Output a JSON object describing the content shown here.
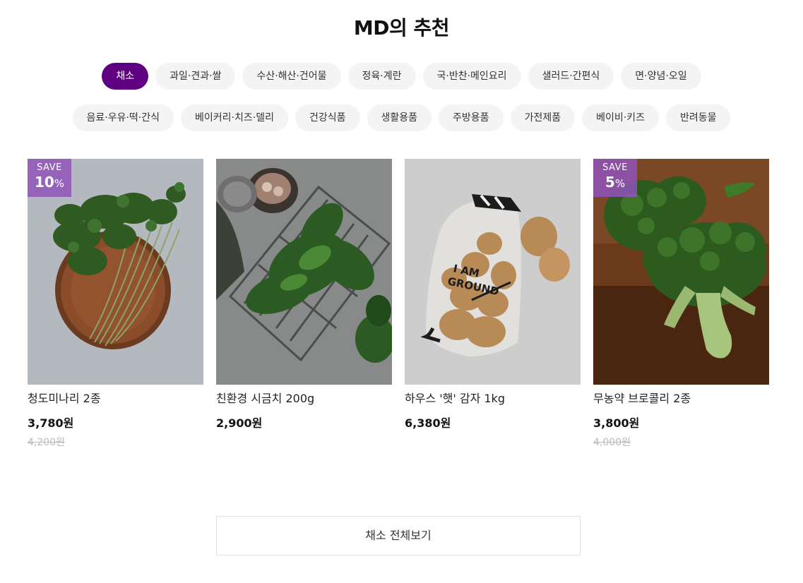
{
  "section": {
    "title": "MD의 추천"
  },
  "categories": {
    "row1": [
      "채소",
      "과일·견과·쌀",
      "수산·해산·건어물",
      "정육·계란",
      "국·반찬·메인요리",
      "샐러드·간편식",
      "면·양념·오일"
    ],
    "row2": [
      "음료·우유·떡·간식",
      "베이커리·치즈·델리",
      "건강식품",
      "생활용품",
      "주방용품",
      "가전제품",
      "베이비·키즈",
      "반려동물"
    ],
    "active": "채소"
  },
  "colors": {
    "accent": "#5f0080",
    "badge": "#8f54ba",
    "chip_bg": "#f4f4f4"
  },
  "products": [
    {
      "name": "청도미나리 2종",
      "price": "3,780원",
      "original_price": "4,200원",
      "save_label": "SAVE",
      "discount": "10",
      "discount_unit": "%",
      "image": "minari-image"
    },
    {
      "name": "친환경 시금치 200g",
      "price": "2,900원",
      "image": "spinach-image"
    },
    {
      "name": "하우스 '햇' 감자 1kg",
      "price": "6,380원",
      "image": "potato-image",
      "bag_text": [
        "I AM",
        "GROUND"
      ]
    },
    {
      "name": "무농약 브로콜리 2종",
      "price": "3,800원",
      "original_price": "4,000원",
      "save_label": "SAVE",
      "discount": "5",
      "discount_unit": "%",
      "image": "broccoli-image"
    }
  ],
  "view_all": {
    "label": "채소 전체보기"
  }
}
